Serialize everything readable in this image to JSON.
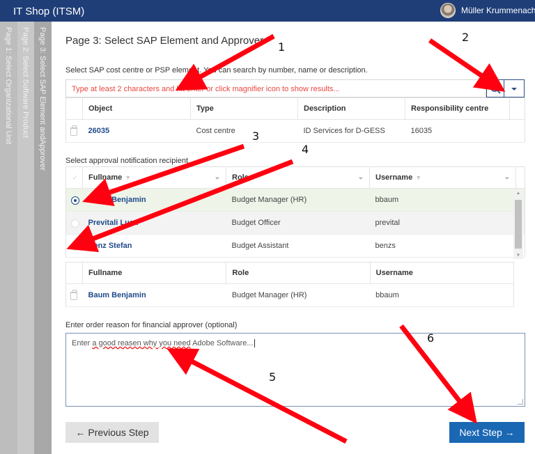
{
  "header": {
    "app_title": "IT Shop (ITSM)",
    "user_name": "Müller Krummenache"
  },
  "steps": [
    {
      "label": "Page 1: Select Organizational Unit"
    },
    {
      "label": "Page 2: Select Software Product"
    },
    {
      "label": "Page 3: Select SAP Element andApprover"
    }
  ],
  "page": {
    "title": "Page 3: Select SAP Element and Approver",
    "sap_label": "Select SAP cost centre or PSP element. You can search by number, name or description.",
    "search_placeholder": "Type at least 2 characters and hit enter or click magnifier icon to show results...",
    "sap_table": {
      "headers": [
        "Object",
        "Type",
        "Description",
        "Responsibility centre"
      ],
      "rows": [
        {
          "object": "26035",
          "type": "Cost centre",
          "description": "ID Services for D-GESS",
          "resp_centre": "16035"
        }
      ]
    },
    "approver_label": "Select approval notification recipient",
    "approver_table": {
      "headers": [
        "Fullname",
        "Role",
        "Username"
      ],
      "rows": [
        {
          "fullname": "Baum Benjamin",
          "role": "Budget Manager (HR)",
          "username": "bbaum",
          "selected": true
        },
        {
          "fullname": "Previtali Luca",
          "role": "Budget Officer",
          "username": "prevital",
          "selected": false
        },
        {
          "fullname": "Benz Stefan",
          "role": "Budget Assistant",
          "username": "benzs",
          "selected": false
        }
      ]
    },
    "selected_table": {
      "headers": [
        "Fullname",
        "Role",
        "Username"
      ],
      "rows": [
        {
          "fullname": "Baum Benjamin",
          "role": "Budget Manager (HR)",
          "username": "bbaum"
        }
      ]
    },
    "reason_label": "Enter order reason for financial approver (optional)",
    "reason_value": "Enter a good reasen why you need Adobe Software...",
    "reason_parts": {
      "p1": "Enter ",
      "p2": "a good reasen why you need",
      "p3": " Adobe Software..."
    }
  },
  "buttons": {
    "previous": "← Previous Step",
    "next": "Next Step →"
  },
  "annotations": [
    "1",
    "2",
    "3",
    "4",
    "5",
    "6"
  ],
  "colors": {
    "header": "#1f3e78",
    "accent": "#1a67b3",
    "placeholder": "#e8473f",
    "arrow": "#ff0000"
  }
}
